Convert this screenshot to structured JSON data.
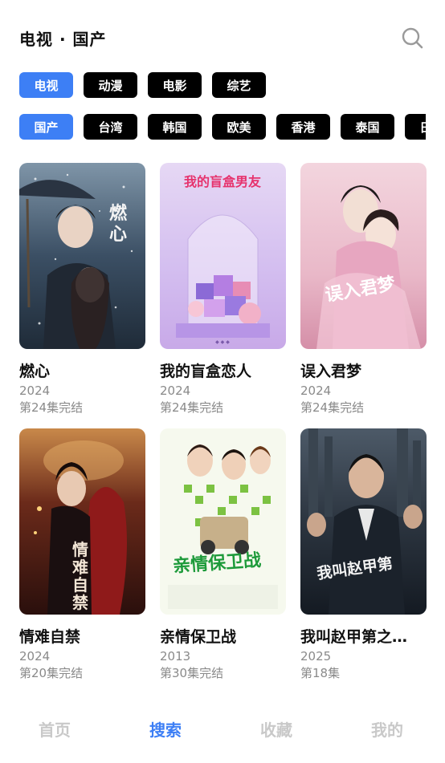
{
  "header": {
    "title": "电视 · 国产",
    "search_icon": "search-icon"
  },
  "categories": [
    {
      "label": "电视",
      "active": true
    },
    {
      "label": "动漫",
      "active": false
    },
    {
      "label": "电影",
      "active": false
    },
    {
      "label": "综艺",
      "active": false
    }
  ],
  "regions": [
    {
      "label": "国产",
      "active": true
    },
    {
      "label": "台湾",
      "active": false
    },
    {
      "label": "韩国",
      "active": false
    },
    {
      "label": "欧美",
      "active": false
    },
    {
      "label": "香港",
      "active": false
    },
    {
      "label": "泰国",
      "active": false
    },
    {
      "label": "日本",
      "active": false
    }
  ],
  "shows": [
    {
      "title": "燃心",
      "year": "2024",
      "status": "第24集完结",
      "poster_text": "燃心"
    },
    {
      "title": "我的盲盒恋人",
      "year": "2024",
      "status": "第24集完结",
      "poster_text": "我的盲盒男友"
    },
    {
      "title": "误入君梦",
      "year": "2024",
      "status": "第24集完结",
      "poster_text": "误入君梦"
    },
    {
      "title": "情难自禁",
      "year": "2024",
      "status": "第20集完结",
      "poster_text": "情难自禁"
    },
    {
      "title": "亲情保卫战",
      "year": "2013",
      "status": "第30集完结",
      "poster_text": "亲情保卫战"
    },
    {
      "title": "我叫赵甲第之…",
      "year": "2025",
      "status": "第18集",
      "poster_text": "我叫赵甲第"
    }
  ],
  "tabs": [
    {
      "label": "首页",
      "active": false
    },
    {
      "label": "搜索",
      "active": true
    },
    {
      "label": "收藏",
      "active": false
    },
    {
      "label": "我的",
      "active": false
    }
  ],
  "colors": {
    "accent": "#3d7ff5",
    "chip": "#000000",
    "muted": "#8a8a8a",
    "tab_inactive": "#c9c9c9"
  }
}
